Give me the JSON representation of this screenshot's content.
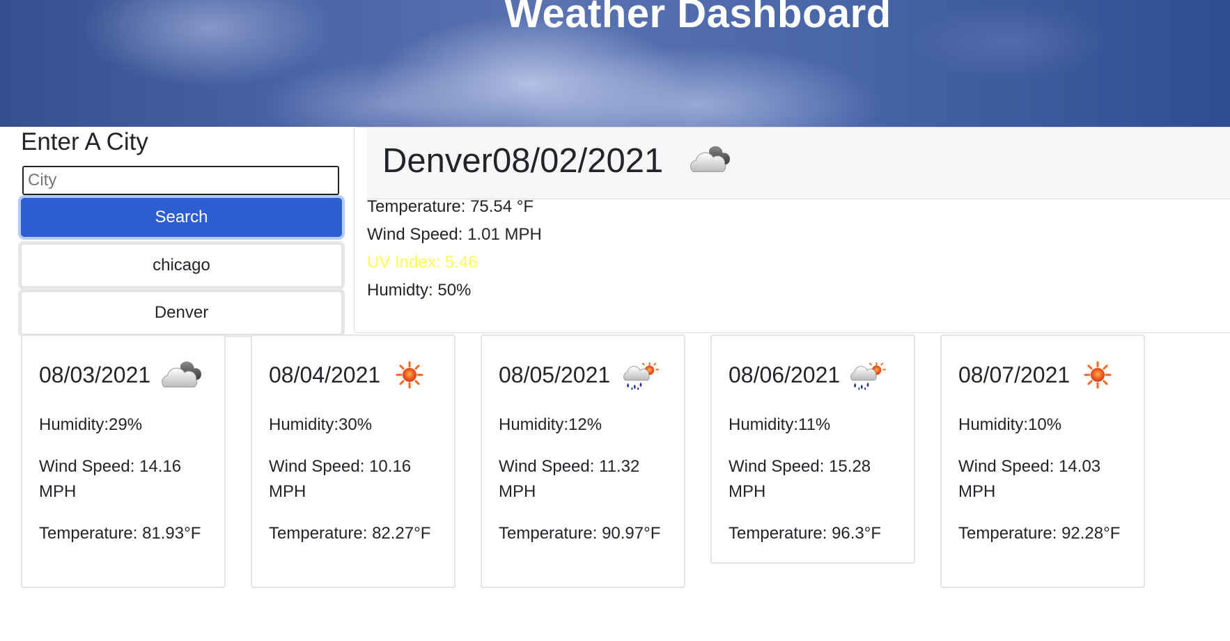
{
  "header": {
    "title": "Weather Dashboard"
  },
  "sidebar": {
    "heading": "Enter A City",
    "input_placeholder": "City",
    "input_value": "",
    "search_label": "Search",
    "history": [
      "chicago",
      "Denver"
    ]
  },
  "current": {
    "title": "Denver08/02/2021",
    "icon": "cloud-icon",
    "temperature": "Temperature: 75.54 °F",
    "wind": "Wind Speed: 1.01 MPH",
    "uv": "UV Index: 5.46",
    "uv_color": "#ffff55",
    "humidity": "Humidty: 50%"
  },
  "forecast": [
    {
      "date": "08/03/2021",
      "icon": "cloud-icon",
      "humidity": "Humidity:29%",
      "wind": "Wind Speed: 14.16 MPH",
      "temp": "Temperature: 81.93°F"
    },
    {
      "date": "08/04/2021",
      "icon": "sun-icon",
      "humidity": "Humidity:30%",
      "wind": "Wind Speed: 10.16 MPH",
      "temp": "Temperature: 82.27°F"
    },
    {
      "date": "08/05/2021",
      "icon": "rain-sun-icon",
      "humidity": "Humidity:12%",
      "wind": "Wind Speed: 11.32 MPH",
      "temp": "Temperature: 90.97°F"
    },
    {
      "date": "08/06/2021",
      "icon": "rain-sun-icon",
      "humidity": "Humidity:11%",
      "wind": "Wind Speed: 15.28 MPH",
      "temp": "Temperature: 96.3°F"
    },
    {
      "date": "08/07/2021",
      "icon": "sun-icon",
      "humidity": "Humidity:10%",
      "wind": "Wind Speed: 14.03 MPH",
      "temp": "Temperature: 92.28°F"
    }
  ],
  "colors": {
    "banner": "#4a64a6",
    "search_button": "#2d5fd3",
    "uv_text": "#ffff55"
  }
}
